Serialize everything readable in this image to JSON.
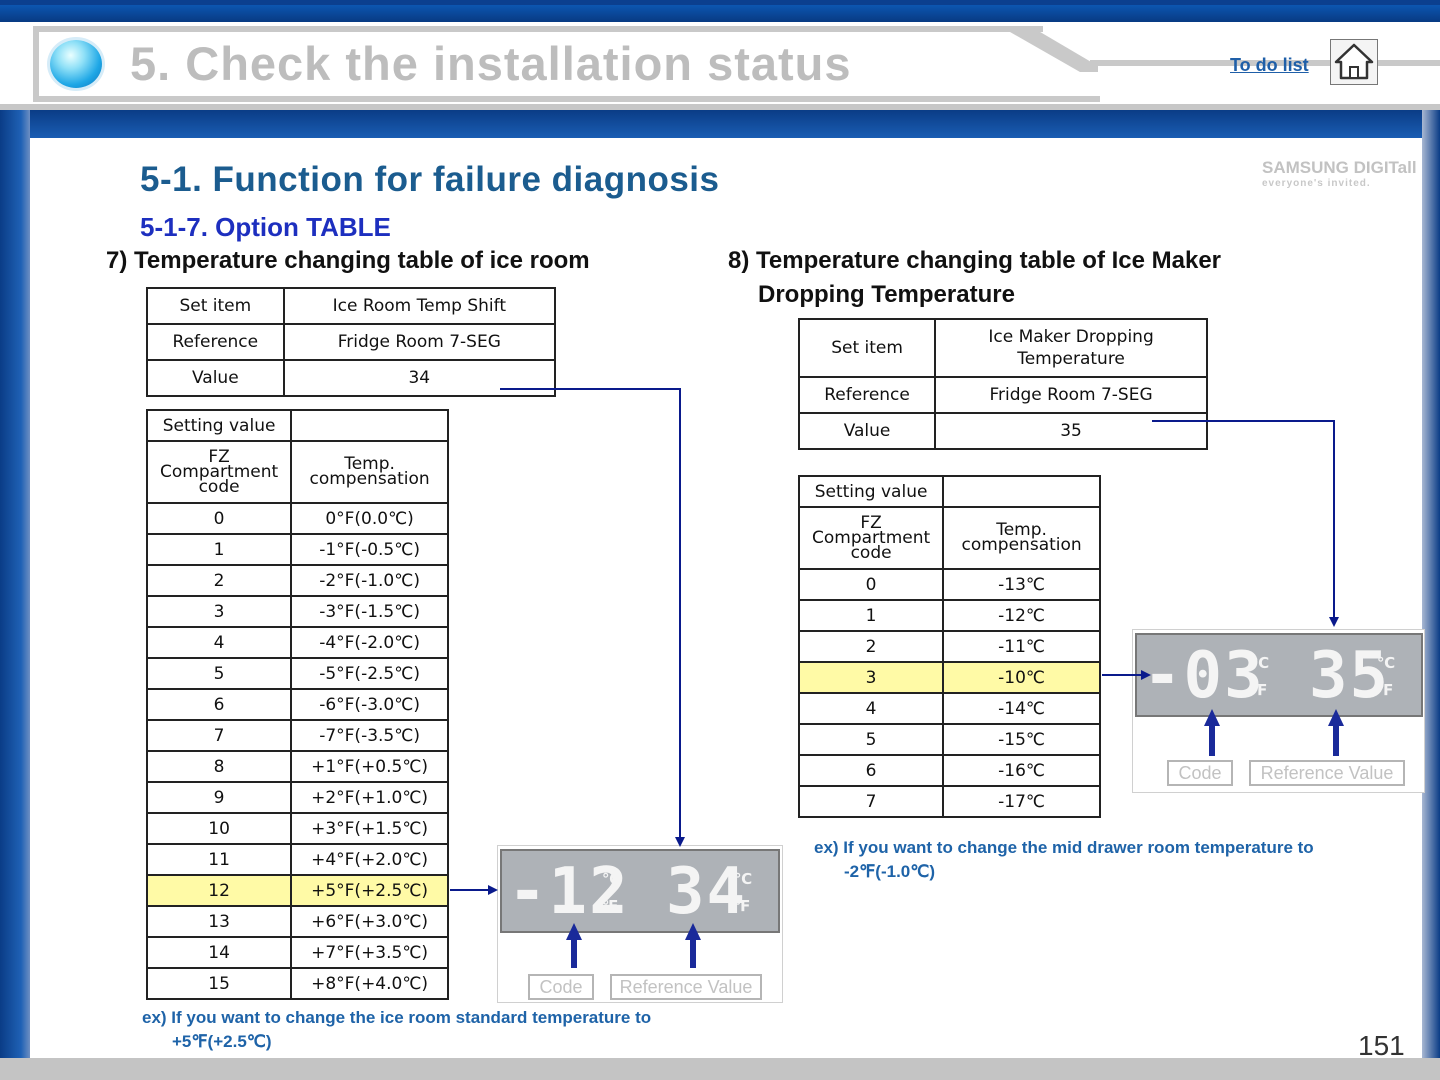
{
  "header": {
    "title": "5. Check the installation status",
    "todo_link": "To do list"
  },
  "logo": {
    "line1": "SAMSUNG DIGITall",
    "line2": "everyone's invited."
  },
  "section_title": "5-1. Function for failure diagnosis",
  "subsection_title": "5-1-7. Option TABLE",
  "left": {
    "heading": "7) Temperature changing table of ice room",
    "info": [
      {
        "key": "Set item",
        "value": "Ice Room Temp Shift"
      },
      {
        "key": "Reference",
        "value": "Fridge Room 7-SEG"
      },
      {
        "key": "Value",
        "value": "34"
      }
    ],
    "setting_value_label": "Setting value",
    "col1": "FZ Compartment code",
    "col2": "Temp. compensation",
    "rows": [
      {
        "code": "0",
        "temp": "0°F(0.0℃)"
      },
      {
        "code": "1",
        "temp": "-1°F(-0.5℃)"
      },
      {
        "code": "2",
        "temp": "-2°F(-1.0℃)"
      },
      {
        "code": "3",
        "temp": "-3°F(-1.5℃)"
      },
      {
        "code": "4",
        "temp": "-4°F(-2.0℃)"
      },
      {
        "code": "5",
        "temp": "-5°F(-2.5℃)"
      },
      {
        "code": "6",
        "temp": "-6°F(-3.0℃)"
      },
      {
        "code": "7",
        "temp": "-7°F(-3.5℃)"
      },
      {
        "code": "8",
        "temp": "+1°F(+0.5℃)"
      },
      {
        "code": "9",
        "temp": "+2°F(+1.0℃)"
      },
      {
        "code": "10",
        "temp": "+3°F(+1.5℃)"
      },
      {
        "code": "11",
        "temp": "+4°F(+2.0℃)"
      },
      {
        "code": "12",
        "temp": "+5°F(+2.5℃)"
      },
      {
        "code": "13",
        "temp": "+6°F(+3.0℃)"
      },
      {
        "code": "14",
        "temp": "+7°F(+3.5℃)"
      },
      {
        "code": "15",
        "temp": "+8°F(+4.0℃)"
      }
    ],
    "highlight_code": "12",
    "display": {
      "code_digits": "-12",
      "value_digits": "34",
      "unit_c": "℃",
      "unit_f": "℉",
      "code_label": "Code",
      "value_label": "Reference Value"
    },
    "example_line1": "ex) If you want to change the ice room standard temperature to",
    "example_line2": "+5℉(+2.5℃)"
  },
  "right": {
    "heading_line1": "8) Temperature changing table of Ice Maker",
    "heading_line2": "Dropping Temperature",
    "info": [
      {
        "key": "Set item",
        "value": "Ice Maker Dropping Temperature"
      },
      {
        "key": "Reference",
        "value": "Fridge Room 7-SEG"
      },
      {
        "key": "Value",
        "value": "35"
      }
    ],
    "setting_value_label": "Setting value",
    "col1": "FZ Compartment code",
    "col2": "Temp. compensation",
    "rows": [
      {
        "code": "0",
        "temp": "-13℃"
      },
      {
        "code": "1",
        "temp": "-12℃"
      },
      {
        "code": "2",
        "temp": "-11℃"
      },
      {
        "code": "3",
        "temp": "-10℃"
      },
      {
        "code": "4",
        "temp": "-14℃"
      },
      {
        "code": "5",
        "temp": "-15℃"
      },
      {
        "code": "6",
        "temp": "-16℃"
      },
      {
        "code": "7",
        "temp": "-17℃"
      }
    ],
    "highlight_code": "3",
    "display": {
      "code_digits": "-03",
      "value_digits": "35",
      "unit_c": "℃",
      "unit_f": "℉",
      "code_label": "Code",
      "value_label": "Reference Value"
    },
    "example_line1": "ex) If you want to change the mid drawer room temperature to",
    "example_line2": "-2℉(-1.0℃)"
  },
  "page_number": "151",
  "colors": {
    "accent_blue": "#1b5c8f",
    "arrow_navy": "#0a1a8c",
    "highlight": "#fffaa6",
    "example_blue": "#1e63a8"
  }
}
